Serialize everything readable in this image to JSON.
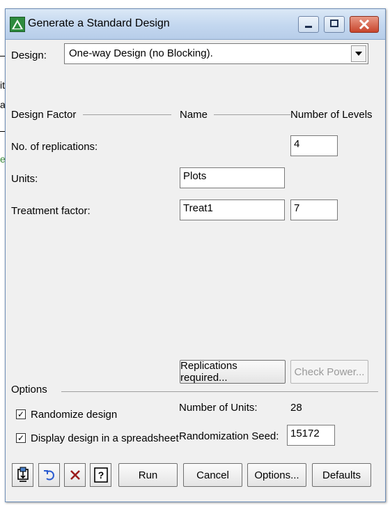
{
  "window": {
    "title": "Generate a Standard Design"
  },
  "background": {
    "t1": "it",
    "t2": "a",
    "t3": "e"
  },
  "design": {
    "label": "Design:",
    "value": "One-way Design (no Blocking)."
  },
  "headers": {
    "factor": "Design Factor",
    "name": "Name",
    "levels": "Number of Levels"
  },
  "rows": {
    "replications": {
      "label": "No. of replications:",
      "levels": "4"
    },
    "units": {
      "label": "Units:",
      "name": "Plots"
    },
    "treatment": {
      "label": "Treatment factor:",
      "name": "Treat1",
      "levels": "7"
    }
  },
  "buttons": {
    "replications_required": "Replications required...",
    "check_power": "Check Power...",
    "run": "Run",
    "cancel": "Cancel",
    "options": "Options...",
    "defaults": "Defaults"
  },
  "options": {
    "title": "Options",
    "randomize": {
      "label": "Randomize design",
      "checked": true
    },
    "display": {
      "label": "Display design in a spreadsheet",
      "checked": true
    },
    "num_units_label": "Number of Units:",
    "num_units_value": "28",
    "seed_label": "Randomization Seed:",
    "seed_value": "15172"
  },
  "checkmark": "✓",
  "icons": [
    "window-icon",
    "minimize-icon",
    "maximize-icon",
    "close-icon",
    "dropdown-arrow-icon",
    "pin-icon",
    "undo-icon",
    "clear-icon",
    "help-icon"
  ],
  "colors": {
    "window_bg": "#f0f0f0",
    "titlebar": "#c3d7ef",
    "close_button": "#c8442c"
  }
}
